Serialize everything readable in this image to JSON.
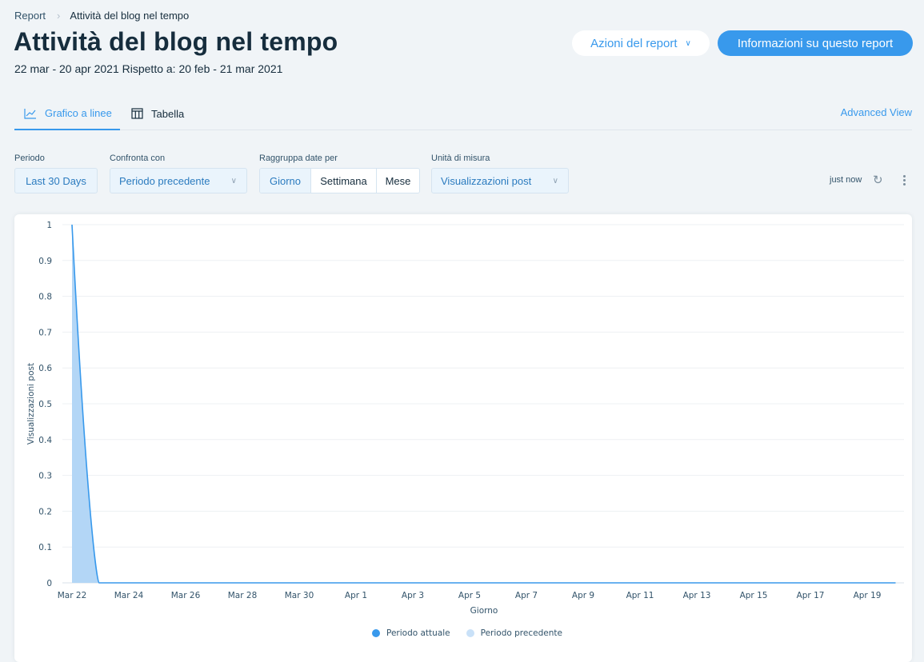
{
  "breadcrumb": {
    "root": "Report",
    "separator": ">",
    "current": "Attività del blog nel tempo"
  },
  "header": {
    "title": "Attività del blog nel tempo",
    "subtitle": "22 mar - 20 apr 2021 Rispetto a: 20 feb - 21 mar 2021",
    "actions_label": "Azioni del report",
    "info_label": "Informazioni su questo report"
  },
  "tabs": [
    {
      "label": "Grafico a linee",
      "icon": "line-chart-icon",
      "active": true
    },
    {
      "label": "Tabella",
      "icon": "table-icon",
      "active": false
    }
  ],
  "advanced_view_label": "Advanced View",
  "controls": {
    "period": {
      "label": "Periodo",
      "value": "Last 30 Days"
    },
    "compare": {
      "label": "Confronta con",
      "value": "Periodo precedente"
    },
    "group_by": {
      "label": "Raggruppa date per",
      "options": [
        "Giorno",
        "Settimana",
        "Mese"
      ],
      "selected": "Giorno"
    },
    "unit": {
      "label": "Unità di misura",
      "value": "Visualizzazioni post"
    },
    "updated": "just now"
  },
  "colors": {
    "accent": "#3899ec",
    "previous_fill": "#b3d6f6"
  },
  "chart_data": {
    "type": "area",
    "title": "",
    "xlabel": "Giorno",
    "ylabel": "Visualizzazioni post",
    "ylim": [
      0,
      1
    ],
    "yticks": [
      "0",
      "0.1",
      "0.2",
      "0.3",
      "0.4",
      "0.5",
      "0.6",
      "0.7",
      "0.8",
      "0.9",
      "1"
    ],
    "xtick_labels": [
      "Mar 22",
      "Mar 24",
      "Mar 26",
      "Mar 28",
      "Mar 30",
      "Apr 1",
      "Apr 3",
      "Apr 5",
      "Apr 7",
      "Apr 9",
      "Apr 11",
      "Apr 13",
      "Apr 15",
      "Apr 17",
      "Apr 19"
    ],
    "x": [
      "Mar 22",
      "Mar 23",
      "Mar 24",
      "Mar 25",
      "Mar 26",
      "Mar 27",
      "Mar 28",
      "Mar 29",
      "Mar 30",
      "Mar 31",
      "Apr 1",
      "Apr 2",
      "Apr 3",
      "Apr 4",
      "Apr 5",
      "Apr 6",
      "Apr 7",
      "Apr 8",
      "Apr 9",
      "Apr 10",
      "Apr 11",
      "Apr 12",
      "Apr 13",
      "Apr 14",
      "Apr 15",
      "Apr 16",
      "Apr 17",
      "Apr 18",
      "Apr 19",
      "Apr 20"
    ],
    "series": [
      {
        "name": "Periodo attuale",
        "style": "line",
        "color": "#3899ec",
        "values": [
          1,
          0,
          0,
          0,
          0,
          0,
          0,
          0,
          0,
          0,
          0,
          0,
          0,
          0,
          0,
          0,
          0,
          0,
          0,
          0,
          0,
          0,
          0,
          0,
          0,
          0,
          0,
          0,
          0,
          0
        ]
      },
      {
        "name": "Periodo precedente",
        "style": "area",
        "color": "#b3d6f6",
        "values": [
          1,
          0,
          0,
          0,
          0,
          0,
          0,
          0,
          0,
          0,
          0,
          0,
          0,
          0,
          0,
          0,
          0,
          0,
          0,
          0,
          0,
          0,
          0,
          0,
          0,
          0,
          0,
          0,
          0,
          0
        ]
      }
    ],
    "grid": true,
    "legend": "bottom-center"
  }
}
